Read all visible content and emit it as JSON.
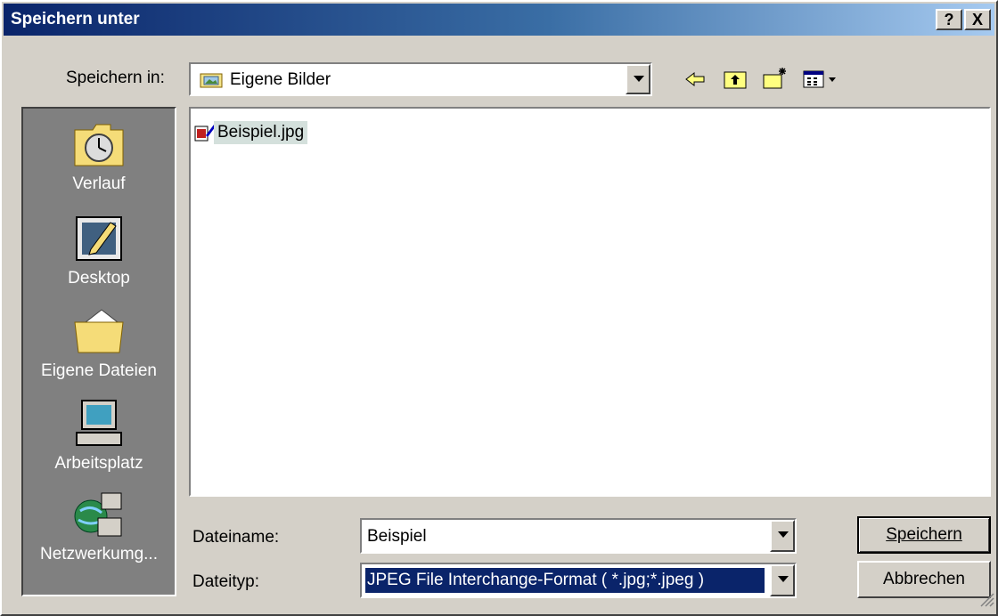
{
  "window": {
    "title": "Speichern unter",
    "help_label": "?",
    "close_label": "X"
  },
  "location": {
    "label": "Speichern in:",
    "value": "Eigene Bilder"
  },
  "toolbar": {
    "back_icon": "back-arrow-icon",
    "up_icon": "up-folder-icon",
    "new_folder_icon": "new-folder-icon",
    "view_icon": "view-menu-icon"
  },
  "places": [
    {
      "label": "Verlauf",
      "icon": "history-icon"
    },
    {
      "label": "Desktop",
      "icon": "desktop-icon"
    },
    {
      "label": "Eigene Dateien",
      "icon": "my-documents-icon"
    },
    {
      "label": "Arbeitsplatz",
      "icon": "my-computer-icon"
    },
    {
      "label": "Netzwerkumg...",
      "icon": "network-icon"
    }
  ],
  "files": [
    {
      "name": "Beispiel.jpg",
      "icon": "jpg-file-icon"
    }
  ],
  "filename": {
    "label": "Dateiname:",
    "value": "Beispiel"
  },
  "filetype": {
    "label": "Dateityp:",
    "value": "JPEG File Interchange-Format ( *.jpg;*.jpeg )"
  },
  "buttons": {
    "save": "Speichern",
    "cancel": "Abbrechen"
  },
  "colors": {
    "titlebar_start": "#0a246a",
    "titlebar_end": "#a6caf0",
    "face": "#d4d0c8",
    "selection": "#0a246a"
  }
}
